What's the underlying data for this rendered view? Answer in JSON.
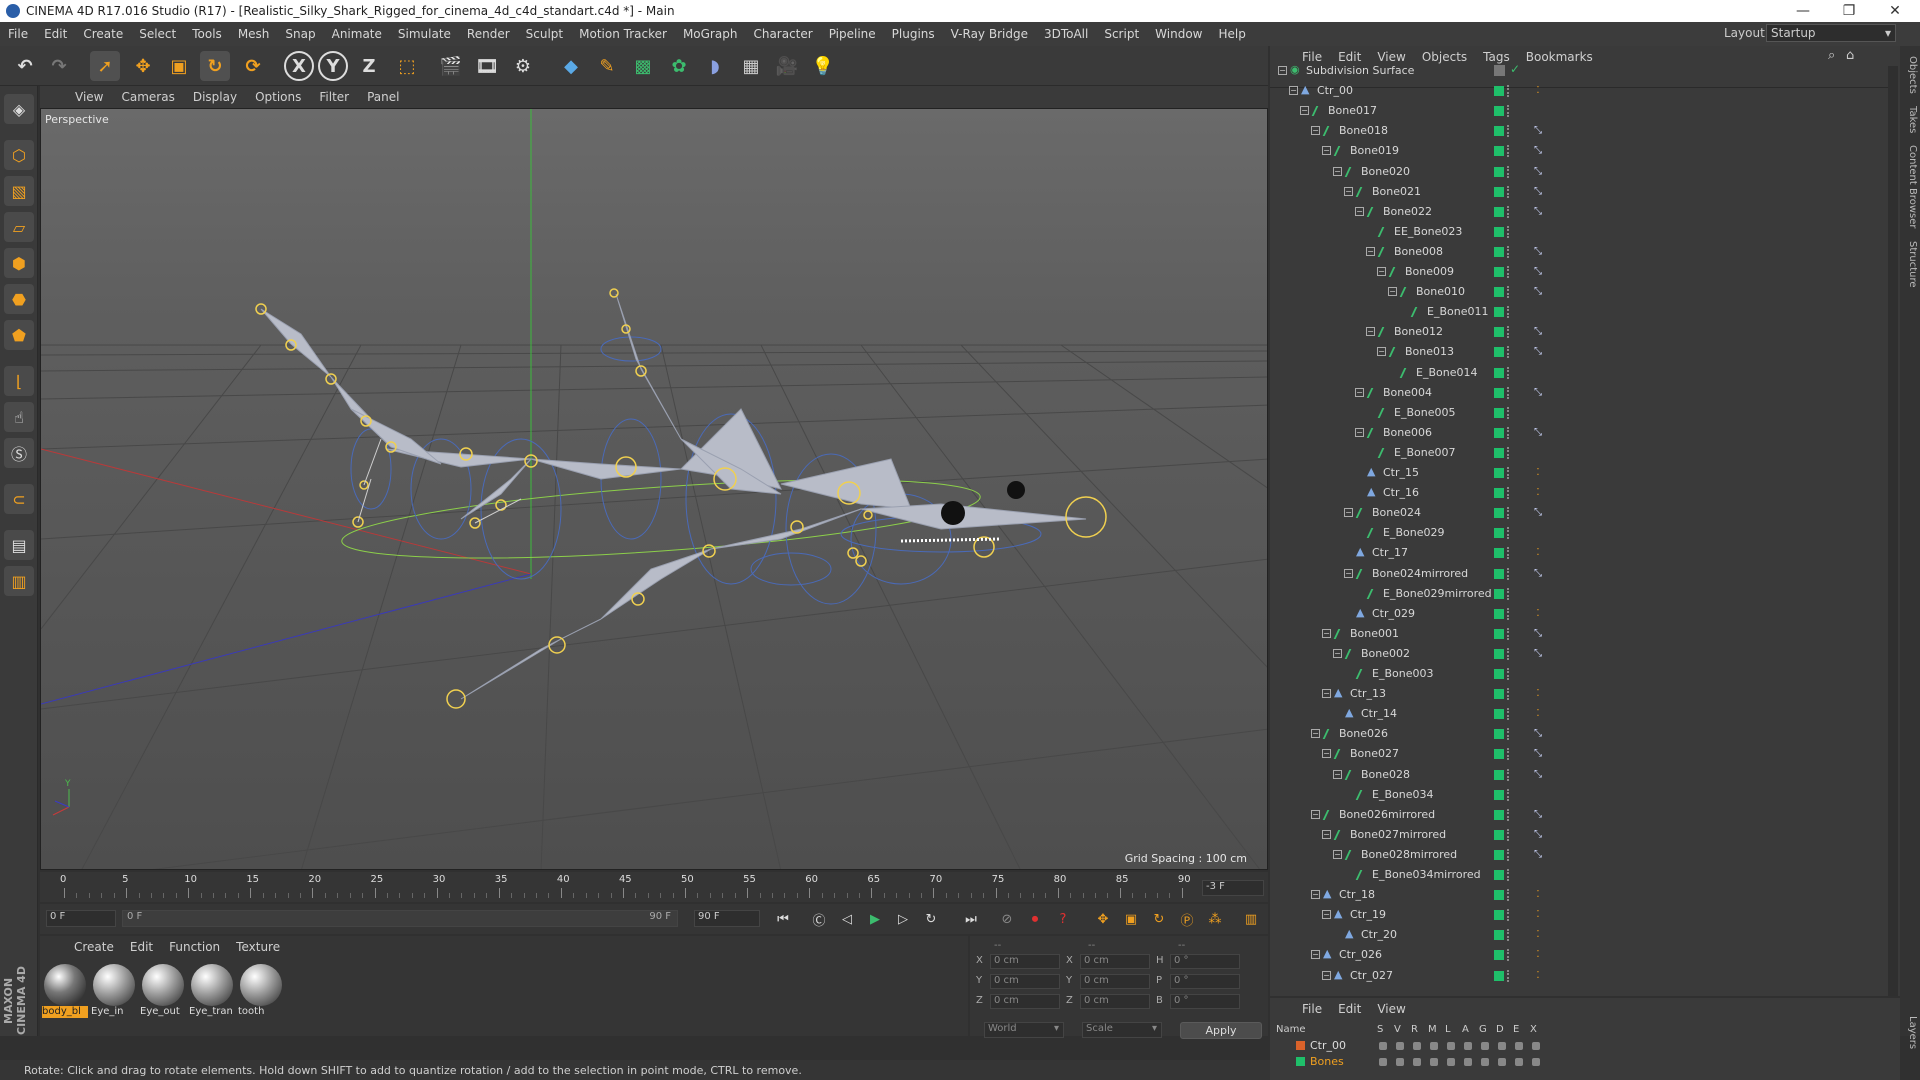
{
  "titlebar": {
    "title": "CINEMA 4D R17.016 Studio (R17) - [Realistic_Silky_Shark_Rigged_for_cinema_4d_c4d_standart.c4d *] - Main"
  },
  "menu": [
    "File",
    "Edit",
    "Create",
    "Select",
    "Tools",
    "Mesh",
    "Snap",
    "Animate",
    "Simulate",
    "Render",
    "Sculpt",
    "Motion Tracker",
    "MoGraph",
    "Character",
    "Pipeline",
    "Plugins",
    "V-Ray Bridge",
    "3DToAll",
    "Script",
    "Window",
    "Help"
  ],
  "layout": {
    "label": "Layout:",
    "value": "Startup"
  },
  "toolbar": {
    "x": "X",
    "y": "Y",
    "z": "Z"
  },
  "viewport": {
    "menu": [
      "View",
      "Cameras",
      "Display",
      "Options",
      "Filter",
      "Panel"
    ],
    "camera_label": "Perspective",
    "grid_spacing": "Grid Spacing : 100 cm",
    "axis_y": "Y"
  },
  "timeline": {
    "ticks": [
      "0",
      "5",
      "10",
      "15",
      "20",
      "25",
      "30",
      "35",
      "40",
      "45",
      "50",
      "55",
      "60",
      "65",
      "70",
      "75",
      "80",
      "85",
      "90"
    ],
    "current_frame_field": "-3 F"
  },
  "transport": {
    "start_field": "0 F",
    "range_start": "0 F",
    "range_end": "90 F",
    "end_field": "90 F"
  },
  "materials": {
    "menu": [
      "Create",
      "Edit",
      "Function",
      "Texture"
    ],
    "items": [
      "body_bl",
      "Eye_in",
      "Eye_out",
      "Eye_tran",
      "tooth"
    ]
  },
  "attributes": {
    "headers": [
      "--",
      "--",
      "--"
    ],
    "rows": [
      {
        "a": "X",
        "av": "0 cm",
        "b": "X",
        "bv": "0 cm",
        "c": "H",
        "cv": "0 °"
      },
      {
        "a": "Y",
        "av": "0 cm",
        "b": "Y",
        "bv": "0 cm",
        "c": "P",
        "cv": "0 °"
      },
      {
        "a": "Z",
        "av": "0 cm",
        "b": "Z",
        "bv": "0 cm",
        "c": "B",
        "cv": "0 °"
      }
    ],
    "coord_select": "World",
    "size_select": "Scale",
    "apply": "Apply"
  },
  "object_manager": {
    "menu": [
      "File",
      "Edit",
      "View",
      "Objects",
      "Tags",
      "Bookmarks"
    ],
    "rows": [
      {
        "name": "Subdivision Surface",
        "depth": 0,
        "type": "sds",
        "exp": "-"
      },
      {
        "name": "Ctr_00",
        "depth": 1,
        "type": "ctr",
        "exp": "-",
        "tag": "o"
      },
      {
        "name": "Bone017",
        "depth": 2,
        "type": "bone",
        "exp": "-"
      },
      {
        "name": "Bone018",
        "depth": 3,
        "type": "bone",
        "exp": "-",
        "tag": "ik"
      },
      {
        "name": "Bone019",
        "depth": 4,
        "type": "bone",
        "exp": "-",
        "tag": "ik"
      },
      {
        "name": "Bone020",
        "depth": 5,
        "type": "bone",
        "exp": "-",
        "tag": "ik"
      },
      {
        "name": "Bone021",
        "depth": 6,
        "type": "bone",
        "exp": "-",
        "tag": "ik"
      },
      {
        "name": "Bone022",
        "depth": 7,
        "type": "bone",
        "exp": "-",
        "tag": "ik"
      },
      {
        "name": "EE_Bone023",
        "depth": 8,
        "type": "bone",
        "exp": ""
      },
      {
        "name": "Bone008",
        "depth": 8,
        "type": "bone",
        "exp": "-",
        "tag": "ik"
      },
      {
        "name": "Bone009",
        "depth": 9,
        "type": "bone",
        "exp": "-",
        "tag": "ik"
      },
      {
        "name": "Bone010",
        "depth": 10,
        "type": "bone",
        "exp": "-",
        "tag": "ik"
      },
      {
        "name": "E_Bone011",
        "depth": 11,
        "type": "bone",
        "exp": ""
      },
      {
        "name": "Bone012",
        "depth": 8,
        "type": "bone",
        "exp": "-",
        "tag": "ik"
      },
      {
        "name": "Bone013",
        "depth": 9,
        "type": "bone",
        "exp": "-",
        "tag": "ik"
      },
      {
        "name": "E_Bone014",
        "depth": 10,
        "type": "bone",
        "exp": ""
      },
      {
        "name": "Bone004",
        "depth": 7,
        "type": "bone",
        "exp": "-",
        "tag": "ik"
      },
      {
        "name": "E_Bone005",
        "depth": 8,
        "type": "bone",
        "exp": ""
      },
      {
        "name": "Bone006",
        "depth": 7,
        "type": "bone",
        "exp": "-",
        "tag": "ik"
      },
      {
        "name": "E_Bone007",
        "depth": 8,
        "type": "bone",
        "exp": ""
      },
      {
        "name": "Ctr_15",
        "depth": 7,
        "type": "ctr",
        "exp": "",
        "tag": "o"
      },
      {
        "name": "Ctr_16",
        "depth": 7,
        "type": "ctr",
        "exp": "",
        "tag": "o"
      },
      {
        "name": "Bone024",
        "depth": 6,
        "type": "bone",
        "exp": "-",
        "tag": "ik"
      },
      {
        "name": "E_Bone029",
        "depth": 7,
        "type": "bone",
        "exp": ""
      },
      {
        "name": "Ctr_17",
        "depth": 6,
        "type": "ctr",
        "exp": "",
        "tag": "o"
      },
      {
        "name": "Bone024mirrored",
        "depth": 6,
        "type": "bone",
        "exp": "-",
        "tag": "ik"
      },
      {
        "name": "E_Bone029mirrored",
        "depth": 7,
        "type": "bone",
        "exp": ""
      },
      {
        "name": "Ctr_029",
        "depth": 6,
        "type": "ctr",
        "exp": "",
        "tag": "o"
      },
      {
        "name": "Bone001",
        "depth": 4,
        "type": "bone",
        "exp": "-",
        "tag": "ik"
      },
      {
        "name": "Bone002",
        "depth": 5,
        "type": "bone",
        "exp": "-",
        "tag": "ik"
      },
      {
        "name": "E_Bone003",
        "depth": 6,
        "type": "bone",
        "exp": ""
      },
      {
        "name": "Ctr_13",
        "depth": 4,
        "type": "ctr",
        "exp": "-",
        "tag": "o"
      },
      {
        "name": "Ctr_14",
        "depth": 5,
        "type": "ctr",
        "exp": "",
        "tag": "o"
      },
      {
        "name": "Bone026",
        "depth": 3,
        "type": "bone",
        "exp": "-",
        "tag": "ik"
      },
      {
        "name": "Bone027",
        "depth": 4,
        "type": "bone",
        "exp": "-",
        "tag": "ik"
      },
      {
        "name": "Bone028",
        "depth": 5,
        "type": "bone",
        "exp": "-",
        "tag": "ik"
      },
      {
        "name": "E_Bone034",
        "depth": 6,
        "type": "bone",
        "exp": ""
      },
      {
        "name": "Bone026mirrored",
        "depth": 3,
        "type": "bone",
        "exp": "-",
        "tag": "ik"
      },
      {
        "name": "Bone027mirrored",
        "depth": 4,
        "type": "bone",
        "exp": "-",
        "tag": "ik"
      },
      {
        "name": "Bone028mirrored",
        "depth": 5,
        "type": "bone",
        "exp": "-",
        "tag": "ik"
      },
      {
        "name": "E_Bone034mirrored",
        "depth": 6,
        "type": "bone",
        "exp": ""
      },
      {
        "name": "Ctr_18",
        "depth": 3,
        "type": "ctr",
        "exp": "-",
        "tag": "o"
      },
      {
        "name": "Ctr_19",
        "depth": 4,
        "type": "ctr",
        "exp": "-",
        "tag": "o"
      },
      {
        "name": "Ctr_20",
        "depth": 5,
        "type": "ctr",
        "exp": "",
        "tag": "o"
      },
      {
        "name": "Ctr_026",
        "depth": 3,
        "type": "ctr",
        "exp": "-",
        "tag": "o"
      },
      {
        "name": "Ctr_027",
        "depth": 4,
        "type": "ctr",
        "exp": "-",
        "tag": "o"
      }
    ]
  },
  "layer_manager": {
    "menu": [
      "File",
      "Edit",
      "View"
    ],
    "headers": [
      "Name",
      "S",
      "V",
      "R",
      "M",
      "L",
      "A",
      "G",
      "D",
      "E",
      "X"
    ],
    "rows": [
      {
        "name": "Ctr_00",
        "color": "#d9622a"
      },
      {
        "name": "Bones",
        "color": "#1fbf6a"
      }
    ]
  },
  "right_tabs": [
    "Objects",
    "Takes",
    "Content Browser",
    "Structure"
  ],
  "right_tabs_bottom": [
    "Layers"
  ],
  "brand": "MAXON CINEMA 4D",
  "status": "Rotate: Click and drag to rotate elements. Hold down SHIFT to add to quantize rotation / add to the selection in point mode, CTRL to remove.",
  "colors": {
    "bone": "#3cbc6e",
    "accent_orange": "#f0a020",
    "selected_green": "#1fbf6a"
  }
}
